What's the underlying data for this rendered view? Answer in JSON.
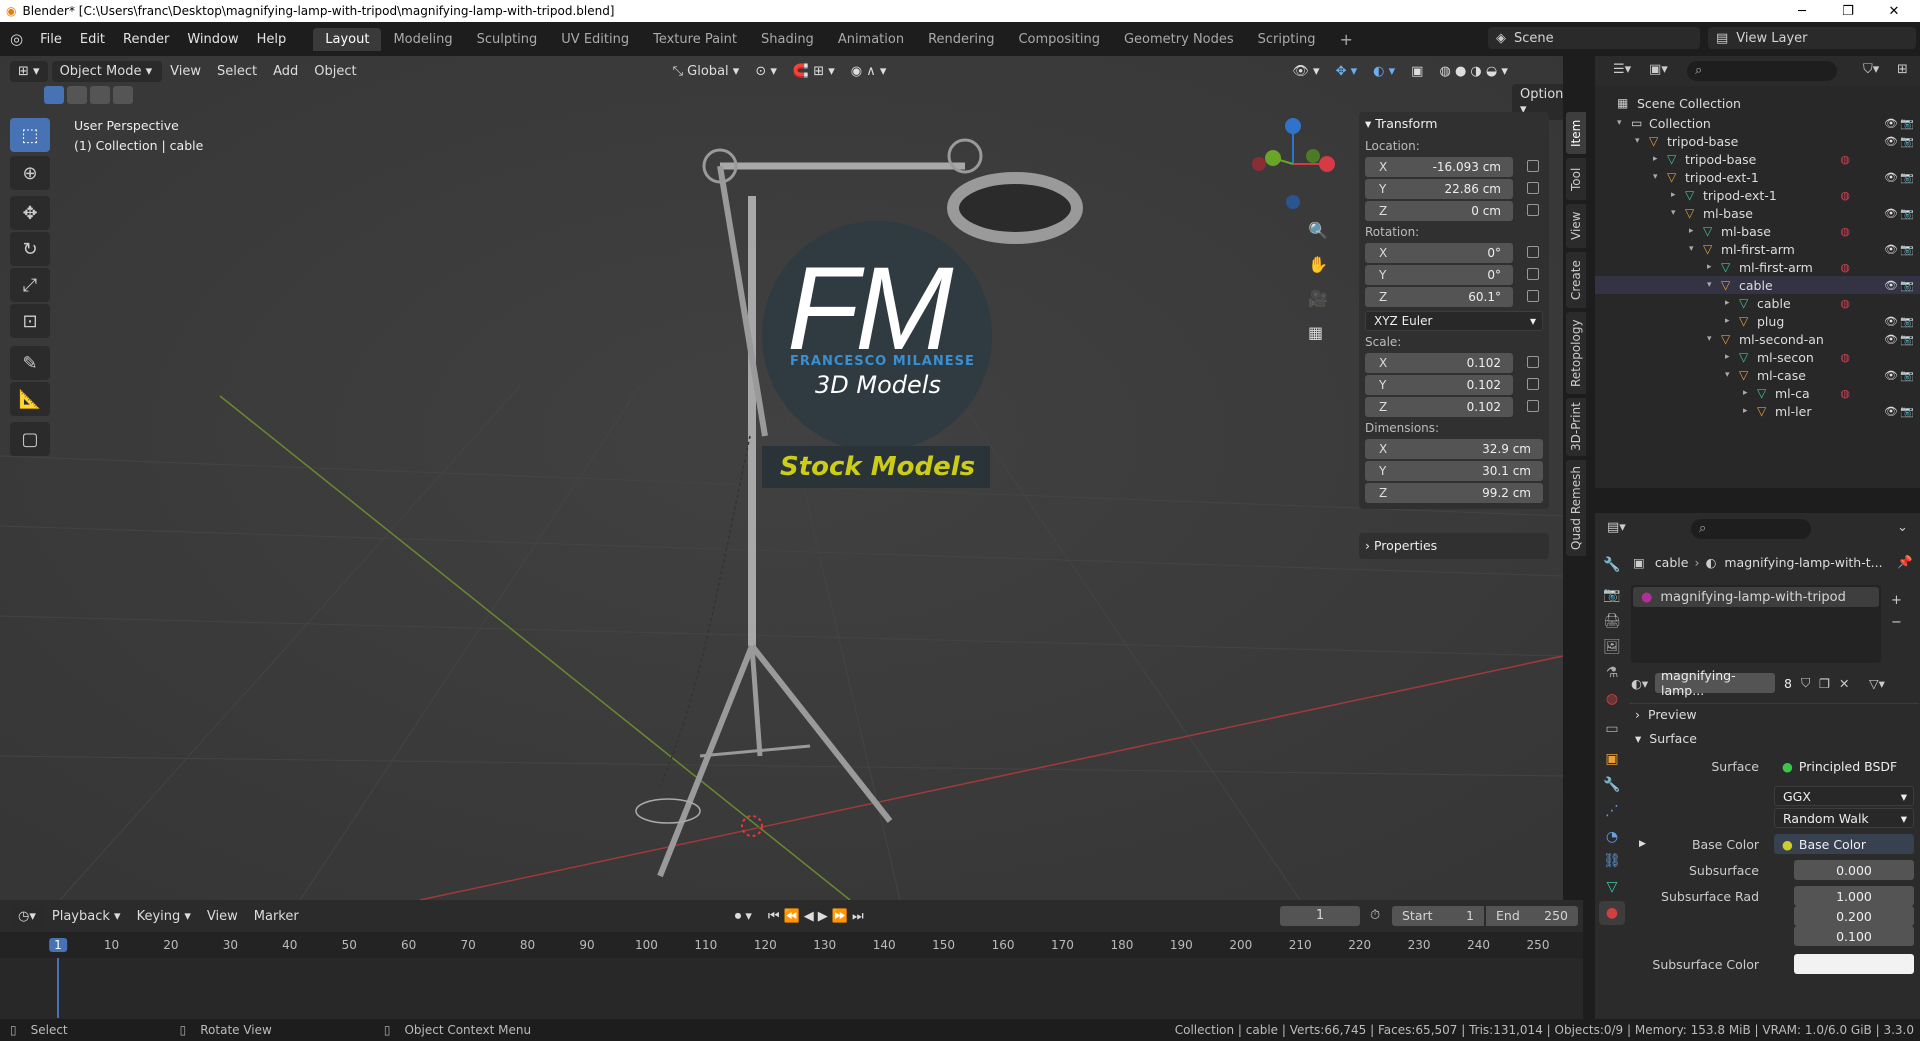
{
  "titlebar": {
    "title": "Blender* [C:\\Users\\franc\\Desktop\\magnifying-lamp-with-tripod\\magnifying-lamp-with-tripod.blend]"
  },
  "menu": [
    "File",
    "Edit",
    "Render",
    "Window",
    "Help"
  ],
  "workspaces": [
    "Layout",
    "Modeling",
    "Sculpting",
    "UV Editing",
    "Texture Paint",
    "Shading",
    "Animation",
    "Rendering",
    "Compositing",
    "Geometry Nodes",
    "Scripting"
  ],
  "scene": {
    "name": "Scene",
    "view_layer": "View Layer"
  },
  "viewport_header": {
    "mode": "Object Mode",
    "view": "View",
    "select": "Select",
    "add": "Add",
    "object": "Object",
    "orientation": "Global",
    "options": "Options"
  },
  "viewport_info": {
    "perspective": "User Perspective",
    "collection": "(1) Collection | cable"
  },
  "logo": {
    "letters": "FM",
    "name": "FRANCESCO MILANESE",
    "sub": "3D Models",
    "banner": "Stock Models"
  },
  "transform": {
    "title": "Transform",
    "location_label": "Location:",
    "location": {
      "x": "-16.093 cm",
      "y": "22.86 cm",
      "z": "0 cm"
    },
    "rotation_label": "Rotation:",
    "rotation": {
      "x": "0°",
      "y": "0°",
      "z": "60.1°"
    },
    "rotation_mode": "XYZ Euler",
    "scale_label": "Scale:",
    "scale": {
      "x": "0.102",
      "y": "0.102",
      "z": "0.102"
    },
    "dimensions_label": "Dimensions:",
    "dimensions": {
      "x": "32.9 cm",
      "y": "30.1 cm",
      "z": "99.2 cm"
    },
    "properties": "Properties",
    "axis": {
      "x": "X",
      "y": "Y",
      "z": "Z"
    }
  },
  "sidetabs": [
    "Item",
    "Tool",
    "View",
    "Create",
    "Retopology",
    "3D-Print",
    "Quad Remesh"
  ],
  "outliner": {
    "scene_collection": "Scene Collection",
    "rows": [
      {
        "name": "Collection",
        "depth": 1,
        "type": "collection"
      },
      {
        "name": "tripod-base",
        "depth": 2,
        "type": "object"
      },
      {
        "name": "tripod-base",
        "depth": 3,
        "type": "mesh"
      },
      {
        "name": "tripod-ext-1",
        "depth": 3,
        "type": "object"
      },
      {
        "name": "tripod-ext-1",
        "depth": 4,
        "type": "mesh"
      },
      {
        "name": "ml-base",
        "depth": 4,
        "type": "object"
      },
      {
        "name": "ml-base",
        "depth": 5,
        "type": "mesh"
      },
      {
        "name": "ml-first-arm",
        "depth": 5,
        "type": "object"
      },
      {
        "name": "ml-first-arm",
        "depth": 6,
        "type": "mesh"
      },
      {
        "name": "cable",
        "depth": 6,
        "type": "object"
      },
      {
        "name": "cable",
        "depth": 7,
        "type": "mesh"
      },
      {
        "name": "plug",
        "depth": 7,
        "type": "object"
      },
      {
        "name": "ml-second-an",
        "depth": 6,
        "type": "object"
      },
      {
        "name": "ml-secon",
        "depth": 7,
        "type": "mesh"
      },
      {
        "name": "ml-case",
        "depth": 7,
        "type": "object"
      },
      {
        "name": "ml-ca",
        "depth": 8,
        "type": "mesh"
      },
      {
        "name": "ml-ler",
        "depth": 8,
        "type": "object"
      }
    ]
  },
  "properties": {
    "breadcrumb_obj": "cable",
    "breadcrumb_mat": "magnifying-lamp-with-t...",
    "slot": "magnifying-lamp-with-tripod",
    "material_name": "magnifying-lamp...",
    "users": "8",
    "preview": "Preview",
    "surface_panel": "Surface",
    "surface_label": "Surface",
    "surface_value": "Principled BSDF",
    "distribution": "GGX",
    "subsurface_method": "Random Walk",
    "base_color_label": "Base Color",
    "base_color_value": "Base Color",
    "subsurface_label": "Subsurface",
    "subsurface_value": "0.000",
    "subsurface_radius_label": "Subsurface Rad",
    "subsurface_radius": [
      "1.000",
      "0.200",
      "0.100"
    ],
    "subsurface_color_label": "Subsurface Color"
  },
  "timeline": {
    "playback": "Playback",
    "keying": "Keying",
    "view": "View",
    "marker": "Marker",
    "current": "1",
    "start_label": "Start",
    "start": "1",
    "end_label": "End",
    "end": "250",
    "ticks": [
      "1",
      "10",
      "20",
      "30",
      "40",
      "50",
      "60",
      "70",
      "80",
      "90",
      "100",
      "110",
      "120",
      "130",
      "140",
      "150",
      "160",
      "170",
      "180",
      "190",
      "200",
      "210",
      "220",
      "230",
      "240",
      "250"
    ]
  },
  "status": {
    "select": "Select",
    "rotate": "Rotate View",
    "context": "Object Context Menu",
    "stats": "Collection | cable | Verts:66,745 | Faces:65,507 | Tris:131,014 | Objects:0/9 | Memory: 153.8 MiB | VRAM: 1.0/6.0 GiB | 3.3.0"
  },
  "colors": {
    "accent": "#4772b3",
    "object": "#e99e39",
    "mesh": "#3cc5a7",
    "logo_bg": "#2f3b40",
    "logo_blue": "#3a8fd0",
    "banner": "#cdcd18"
  }
}
